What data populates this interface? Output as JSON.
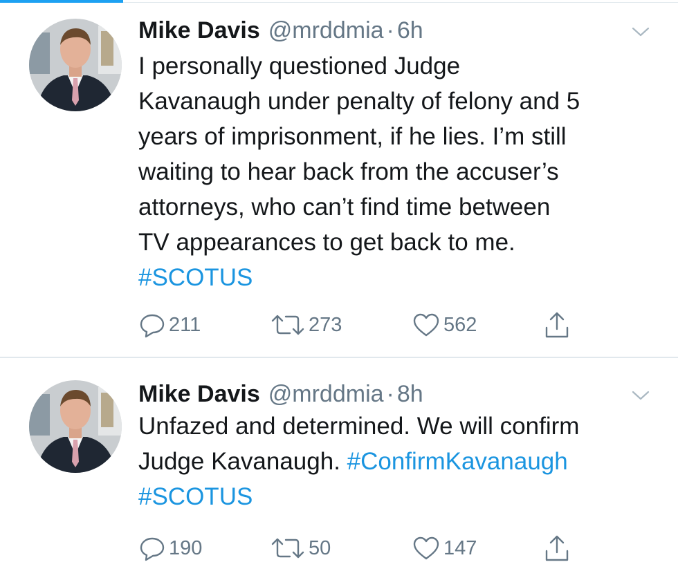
{
  "colors": {
    "accent": "#1da1f2",
    "link": "#1b95e0",
    "text": "#14171a",
    "secondary": "#657786",
    "divider": "#e1e8ed"
  },
  "tweets": [
    {
      "name": "Mike Davis",
      "handle": "@mrddmia",
      "separator": "·",
      "time": "6h",
      "lines": [
        "I personally questioned Judge",
        "Kavanaugh under penalty of felony and 5",
        "years of imprisonment, if he lies. I’m still",
        "waiting to hear back from the accuser’s",
        "attorneys, who can’t find time between",
        "TV appearances to get back to me."
      ],
      "hashtag": "#SCOTUS",
      "replies": "211",
      "retweets": "273",
      "likes": "562",
      "icons": [
        "reply-icon",
        "retweet-icon",
        "like-icon",
        "share-icon",
        "chevron-down-icon"
      ]
    },
    {
      "name": "Mike Davis",
      "handle": "@mrddmia",
      "separator": "·",
      "time": "8h",
      "line1": "Unfazed and determined. We will confirm",
      "line2_text": "Judge Kavanaugh. ",
      "line2_hashtag": "#ConfirmKavanaugh",
      "hashtag": "#SCOTUS",
      "replies": "190",
      "retweets": "50",
      "likes": "147",
      "icons": [
        "reply-icon",
        "retweet-icon",
        "like-icon",
        "share-icon",
        "chevron-down-icon"
      ]
    }
  ]
}
